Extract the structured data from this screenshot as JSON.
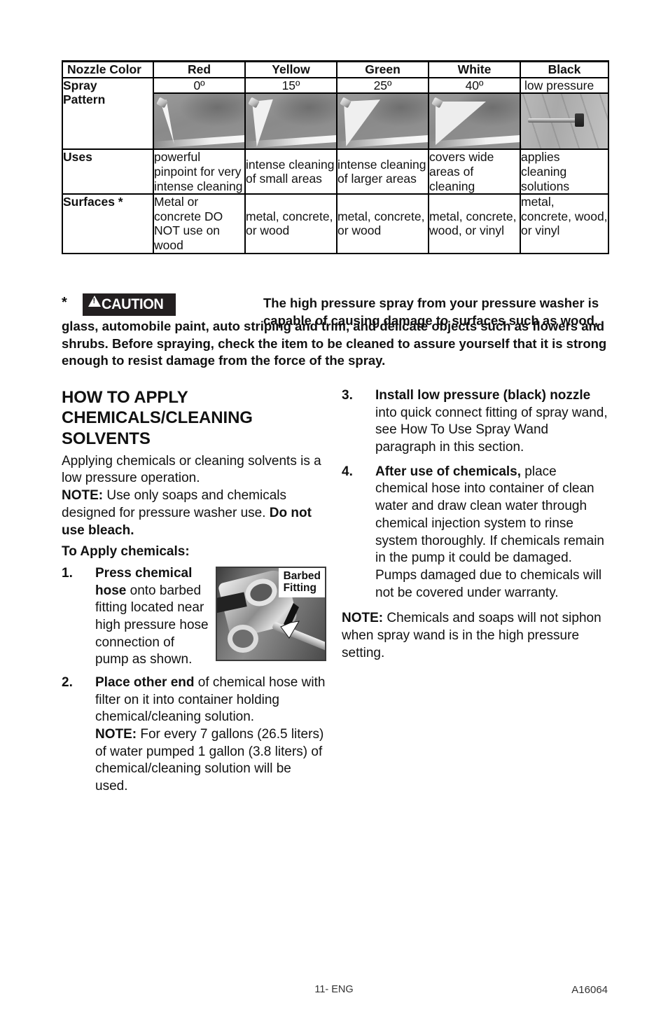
{
  "table": {
    "row_labels": [
      "Nozzle Color",
      "Spray Pattern",
      "Uses",
      "Surfaces *"
    ],
    "label_nozzle_color": "Nozzle Color",
    "label_spray_pattern_line1": "Spray",
    "label_spray_pattern_line2": "Pattern",
    "label_uses": "Uses",
    "label_surfaces": "Surfaces *",
    "colors": [
      "Red",
      "Yellow",
      "Green",
      "White",
      "Black"
    ],
    "angles": [
      "0º",
      "15º",
      "25º",
      "40º",
      "low pressure"
    ],
    "uses": [
      "powerful pinpoint for very intense cleaning",
      "intense cleaning of small areas",
      "intense cleaning of larger areas",
      "covers wide areas of cleaning",
      "applies cleaning solutions"
    ],
    "surfaces": [
      "Metal or concrete DO NOT use on wood",
      "metal, concrete, or wood",
      "metal, concrete, or wood",
      "metal, concrete, wood, or vinyl",
      "metal, concrete, wood, or vinyl"
    ]
  },
  "caution": {
    "star": "*",
    "badge_label": "CAUTION",
    "lead": "The high pressure spray from your pressure washer is capable of causing damage to surfaces such as wood,",
    "rest": "glass, automobile paint, auto striping and trim, and delicate objects such as flowers and shrubs. Before spraying, check the item to be cleaned to assure yourself that it is strong enough to resist damage from the force of the spray."
  },
  "left_column": {
    "title": "HOW TO APPLY CHEMICALS/CLEANING SOLVENTS",
    "intro": "Applying chemicals or cleaning solvents is a low pressure operation.",
    "note_label": "NOTE:",
    "note_text": " Use only soaps and chemicals designed for pressure washer use. ",
    "note_bold_tail": "Do not use bleach.",
    "subheading": "To Apply chemicals:",
    "steps": [
      {
        "num": "1.",
        "bold": "Press chemical hose",
        "text": " onto barbed fitting located near high pressure hose connection of pump as shown."
      },
      {
        "num": "2.",
        "bold": "Place other end",
        "text": " of chemical hose with filter on it into container holding chemical/cleaning solution.",
        "note_label": "NOTE:",
        "note_text": " For every 7 gallons (26.5 liters) of water pumped 1 gallon (3.8 liters) of chemical/cleaning solution will be used."
      }
    ],
    "figure": {
      "callout_line1": "Barbed",
      "callout_line2": "Fitting"
    }
  },
  "right_column": {
    "steps": [
      {
        "num": "3.",
        "bold": "Install low pressure (black) nozzle",
        "text": " into quick connect fitting of spray wand, see How To Use Spray Wand paragraph in this section."
      },
      {
        "num": "4.",
        "bold": "After use of chemicals,",
        "text": " place chemical hose into container of clean water and draw clean water through chemical injection system to rinse system thoroughly. If chemicals remain in the pump it could be damaged. Pumps damaged due to chemicals will not be covered under warranty."
      }
    ],
    "note_label": "NOTE:",
    "note_text": " Chemicals and soaps will not siphon when spray wand is in the high pressure setting."
  },
  "footer": {
    "page": "11- ENG",
    "doc_id": "A16064"
  }
}
